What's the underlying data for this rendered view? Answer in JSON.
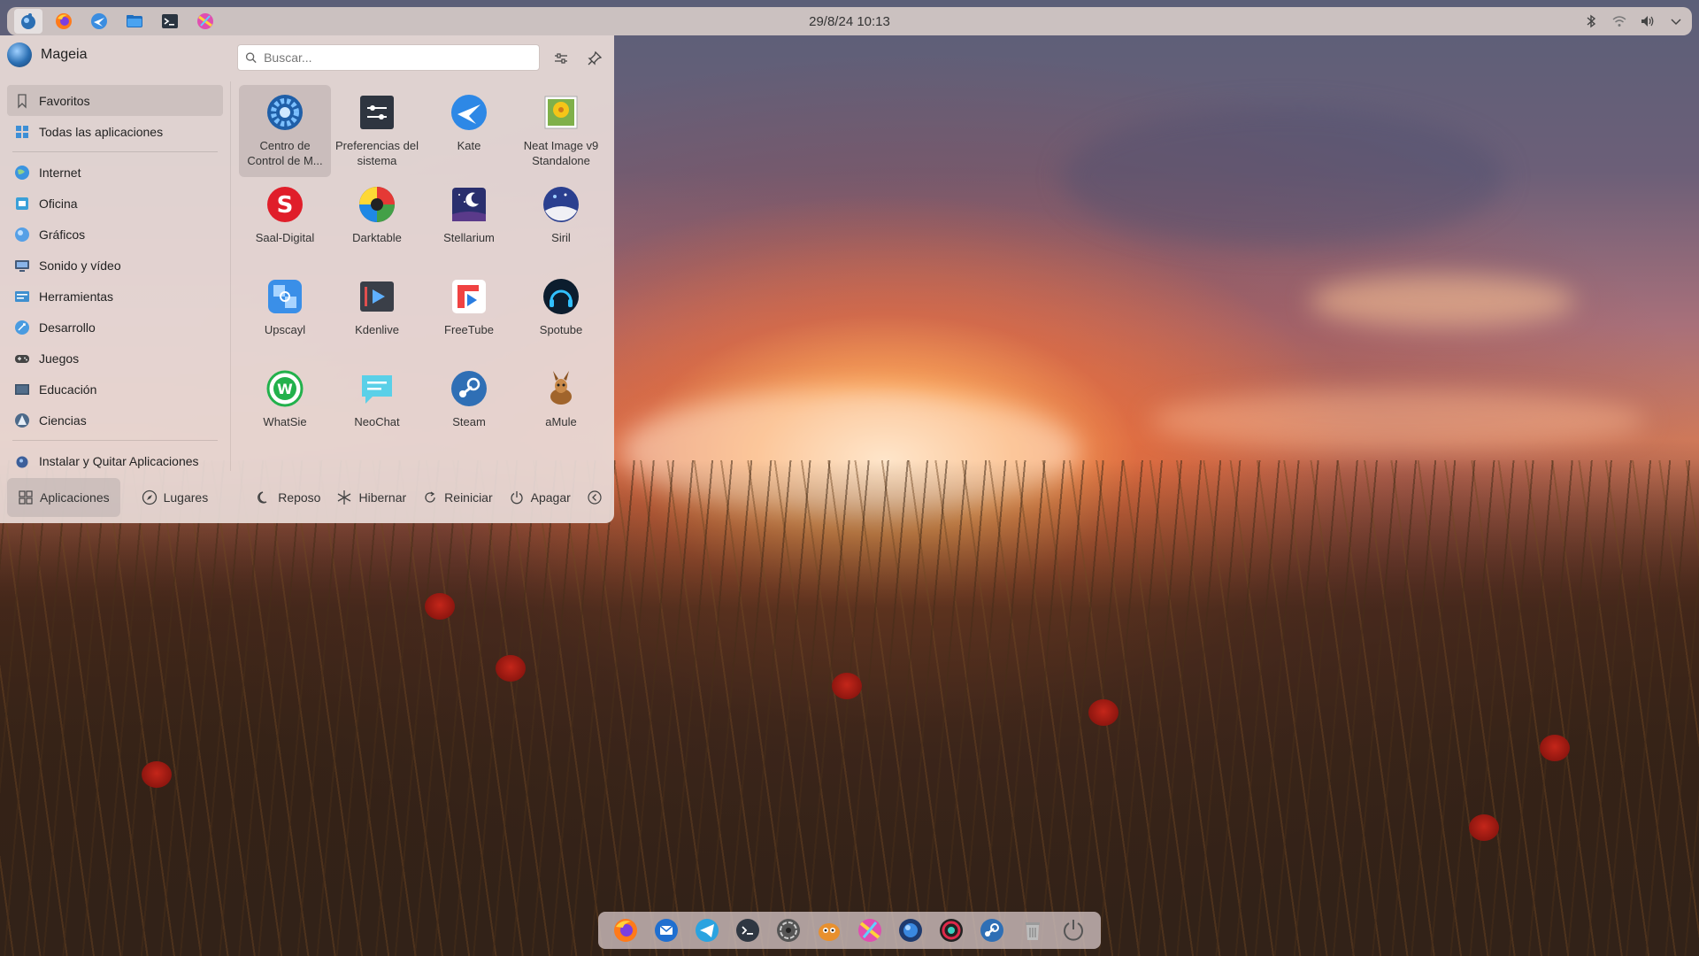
{
  "top_panel": {
    "clock": "29/8/24 10:13",
    "launchers": [
      "mageia-logo-icon",
      "firefox-icon",
      "kate-icon",
      "file-manager-icon",
      "terminal-icon",
      "kdenlive-icon"
    ],
    "tray": [
      "bluetooth-icon",
      "network-icon",
      "volume-icon",
      "chevron-down-icon"
    ]
  },
  "launcher": {
    "distro_name": "Mageia",
    "search": {
      "placeholder": "Buscar...",
      "value": ""
    },
    "categories": [
      {
        "label": "Favoritos",
        "selected": true,
        "color": "#9a8e8b"
      },
      {
        "label": "Todas las aplicaciones",
        "selected": false,
        "color": "#3d8fd6"
      },
      {
        "label": "Internet",
        "selected": false,
        "color": "#3b94e0"
      },
      {
        "label": "Oficina",
        "selected": false,
        "color": "#3aa0d8"
      },
      {
        "label": "Gráficos",
        "selected": false,
        "color": "#56a0e6"
      },
      {
        "label": "Sonido y vídeo",
        "selected": false,
        "color": "#455a78"
      },
      {
        "label": "Herramientas",
        "selected": false,
        "color": "#3f8fcf"
      },
      {
        "label": "Desarrollo",
        "selected": false,
        "color": "#4a9be0"
      },
      {
        "label": "Juegos",
        "selected": false,
        "color": "#444"
      },
      {
        "label": "Educación",
        "selected": false,
        "color": "#3a4f66"
      },
      {
        "label": "Ciencias",
        "selected": false,
        "color": "#4d6a8a"
      },
      {
        "label": "Instalar y Quitar Aplicaciones",
        "selected": false,
        "color": "#3c5f9a"
      }
    ],
    "apps": [
      {
        "label": "Centro de Control de M...",
        "icon": "control-center-icon",
        "hovered": true
      },
      {
        "label": "Preferencias del sistema",
        "icon": "system-settings-icon",
        "hovered": false
      },
      {
        "label": "Kate",
        "icon": "kate-icon",
        "hovered": false
      },
      {
        "label": "Neat Image v9 Standalone",
        "icon": "neat-image-icon",
        "hovered": false
      },
      {
        "label": "Saal-Digital",
        "icon": "saal-digital-icon",
        "hovered": false
      },
      {
        "label": "Darktable",
        "icon": "darktable-icon",
        "hovered": false
      },
      {
        "label": "Stellarium",
        "icon": "stellarium-icon",
        "hovered": false
      },
      {
        "label": "Siril",
        "icon": "siril-icon",
        "hovered": false
      },
      {
        "label": "Upscayl",
        "icon": "upscayl-icon",
        "hovered": false
      },
      {
        "label": "Kdenlive",
        "icon": "kdenlive-icon",
        "hovered": false
      },
      {
        "label": "FreeTube",
        "icon": "freetube-icon",
        "hovered": false
      },
      {
        "label": "Spotube",
        "icon": "spotube-icon",
        "hovered": false
      },
      {
        "label": "WhatSie",
        "icon": "whatsie-icon",
        "hovered": false
      },
      {
        "label": "NeoChat",
        "icon": "neochat-icon",
        "hovered": false
      },
      {
        "label": "Steam",
        "icon": "steam-icon",
        "hovered": false
      },
      {
        "label": "aMule",
        "icon": "amule-icon",
        "hovered": false
      }
    ],
    "footer": {
      "applications": "Aplicaciones",
      "places": "Lugares",
      "sleep": "Reposo",
      "hibernate": "Hibernar",
      "restart": "Reiniciar",
      "shutdown": "Apagar"
    }
  },
  "dock": [
    "firefox-icon",
    "thunderbird-icon",
    "telegram-icon",
    "terminal-icon",
    "aperture-icon",
    "gimp-icon",
    "kdenlive-icon",
    "browser-icon",
    "record-icon",
    "steam-icon",
    "trash-icon",
    "power-icon"
  ]
}
